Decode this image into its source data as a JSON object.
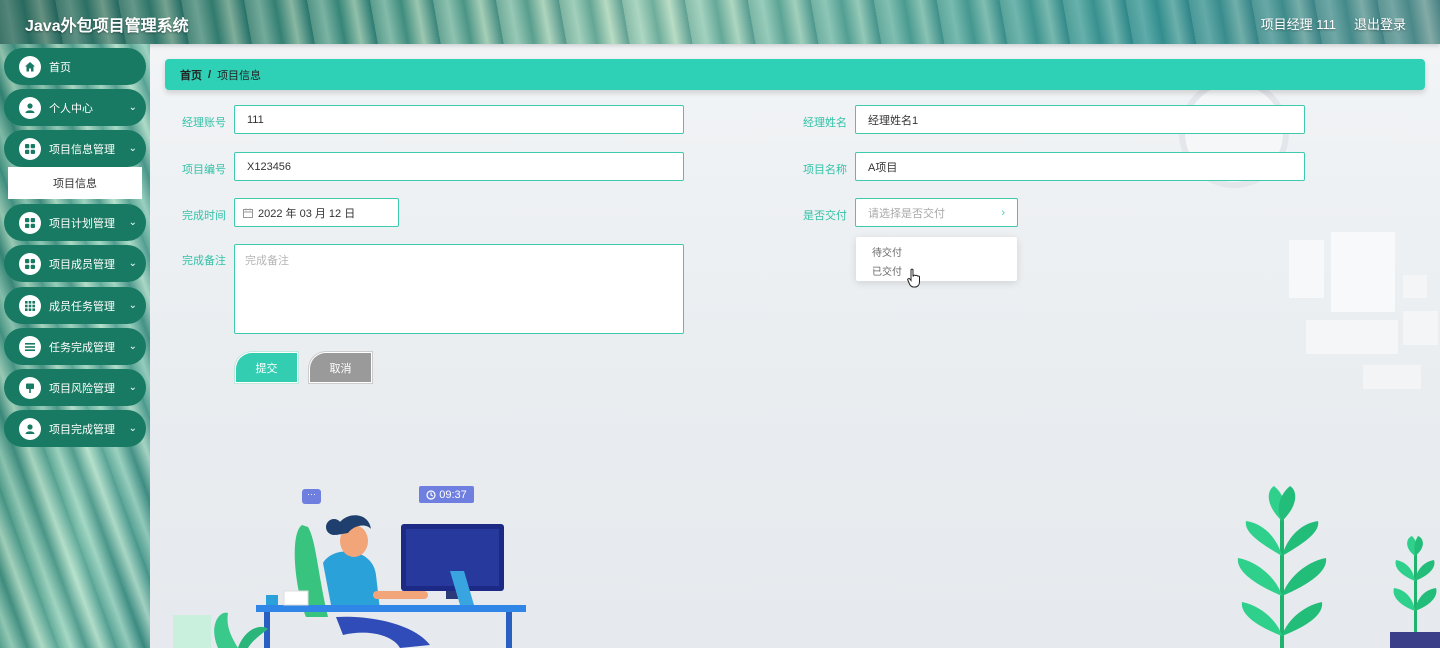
{
  "app": {
    "title": "Java外包项目管理系统"
  },
  "header": {
    "user": "项目经理 111",
    "logout": "退出登录"
  },
  "sidebar": {
    "items": [
      {
        "label": "首页",
        "icon": "home-icon",
        "expandable": false
      },
      {
        "label": "个人中心",
        "icon": "user-icon",
        "expandable": true
      },
      {
        "label": "项目信息管理",
        "icon": "grid-icon",
        "expandable": true
      },
      {
        "label": "项目计划管理",
        "icon": "grid-icon",
        "expandable": true
      },
      {
        "label": "项目成员管理",
        "icon": "grid-icon",
        "expandable": true
      },
      {
        "label": "成员任务管理",
        "icon": "apps-icon",
        "expandable": true
      },
      {
        "label": "任务完成管理",
        "icon": "list-icon",
        "expandable": true
      },
      {
        "label": "项目风险管理",
        "icon": "flag-icon",
        "expandable": true
      },
      {
        "label": "项目完成管理",
        "icon": "person-icon",
        "expandable": true
      }
    ],
    "active_sub": "项目信息"
  },
  "breadcrumb": {
    "home": "首页",
    "separator": "/",
    "current": "项目信息"
  },
  "form": {
    "manager_account": {
      "label": "经理账号",
      "value": "111"
    },
    "manager_name": {
      "label": "经理姓名",
      "value": "经理姓名1"
    },
    "project_code": {
      "label": "项目编号",
      "value": "X123456"
    },
    "project_name": {
      "label": "项目名称",
      "value": "A项目"
    },
    "finish_time": {
      "label": "完成时间",
      "value": "2022 年 03 月 12 日"
    },
    "delivered": {
      "label": "是否交付",
      "placeholder": "请选择是否交付",
      "options": [
        "待交付",
        "已交付"
      ]
    },
    "finish_note": {
      "label": "完成备注",
      "placeholder": "完成备注"
    },
    "submit_label": "提交",
    "cancel_label": "取消"
  },
  "decoration": {
    "clock_time": "09:37"
  },
  "colors": {
    "accent": "#2fd1b6",
    "sidebar_item": "#187a62",
    "label": "#33c2a7"
  }
}
